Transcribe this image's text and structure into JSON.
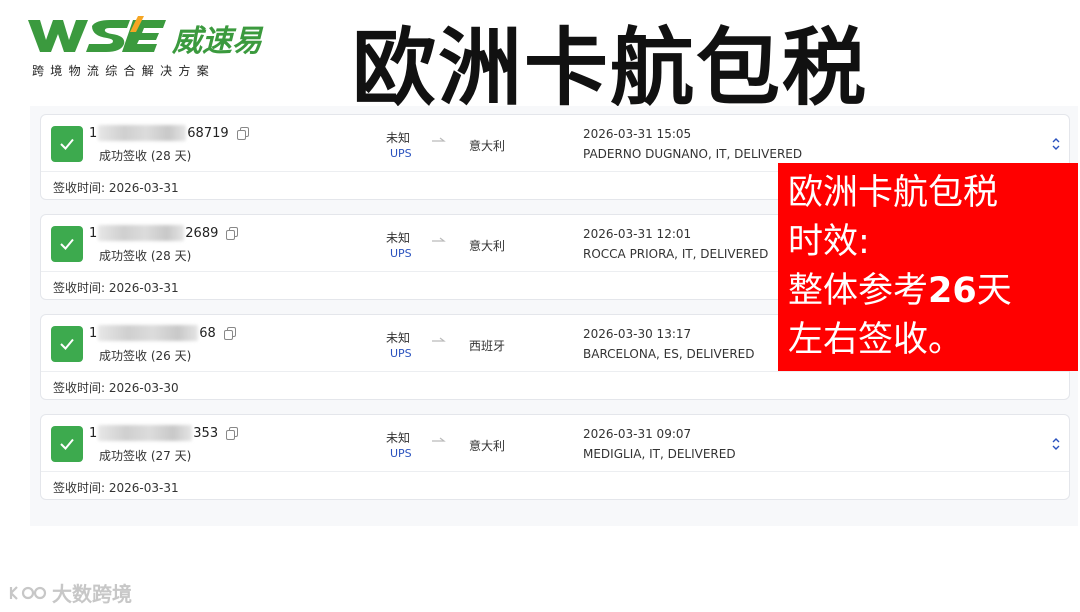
{
  "brand": {
    "logo_letters": "WSE",
    "logo_name": "威速易",
    "tagline": "跨境物流综合解决方案",
    "primary_color": "#3b9a3e",
    "accent_color": "#f6a623"
  },
  "page_title": "欧洲卡航包税",
  "shipments": [
    {
      "tracking_prefix": "1",
      "tracking_suffix": "68719",
      "status": "成功签收 (28 天)",
      "origin": "未知",
      "carrier": "UPS",
      "destination": "意大利",
      "event_time": "2026-03-31 15:05",
      "event_location": "PADERNO DUGNANO, IT, DELIVERED",
      "sign_date": "签收时间: 2026-03-31"
    },
    {
      "tracking_prefix": "1",
      "tracking_suffix": "2689",
      "status": "成功签收 (28 天)",
      "origin": "未知",
      "carrier": "UPS",
      "destination": "意大利",
      "event_time": "2026-03-31 12:01",
      "event_location": "ROCCA PRIORA, IT, DELIVERED",
      "sign_date": "签收时间: 2026-03-31"
    },
    {
      "tracking_prefix": "1",
      "tracking_suffix": "68",
      "status": "成功签收 (26 天)",
      "origin": "未知",
      "carrier": "UPS",
      "destination": "西班牙",
      "event_time": "2026-03-30 13:17",
      "event_location": "BARCELONA, ES, DELIVERED",
      "sign_date": "签收时间: 2026-03-30"
    },
    {
      "tracking_prefix": "1",
      "tracking_suffix": "353",
      "status": "成功签收 (27 天)",
      "origin": "未知",
      "carrier": "UPS",
      "destination": "意大利",
      "event_time": "2026-03-31 09:07",
      "event_location": "MEDIGLIA, IT, DELIVERED",
      "sign_date": "签收时间: 2026-03-31"
    }
  ],
  "callout": {
    "line1": "欧洲卡航包税",
    "line2": "时效:",
    "line3_prefix": "整体参考",
    "line3_number": "26",
    "line3_suffix": "天",
    "line4": "左右签收。",
    "background": "#ff0000"
  },
  "watermark": {
    "text": "大数跨境"
  },
  "icons": {
    "status": "check-icon",
    "copy": "copy-icon",
    "route": "arrow-right-icon",
    "expand": "expand-chevron-icon"
  }
}
